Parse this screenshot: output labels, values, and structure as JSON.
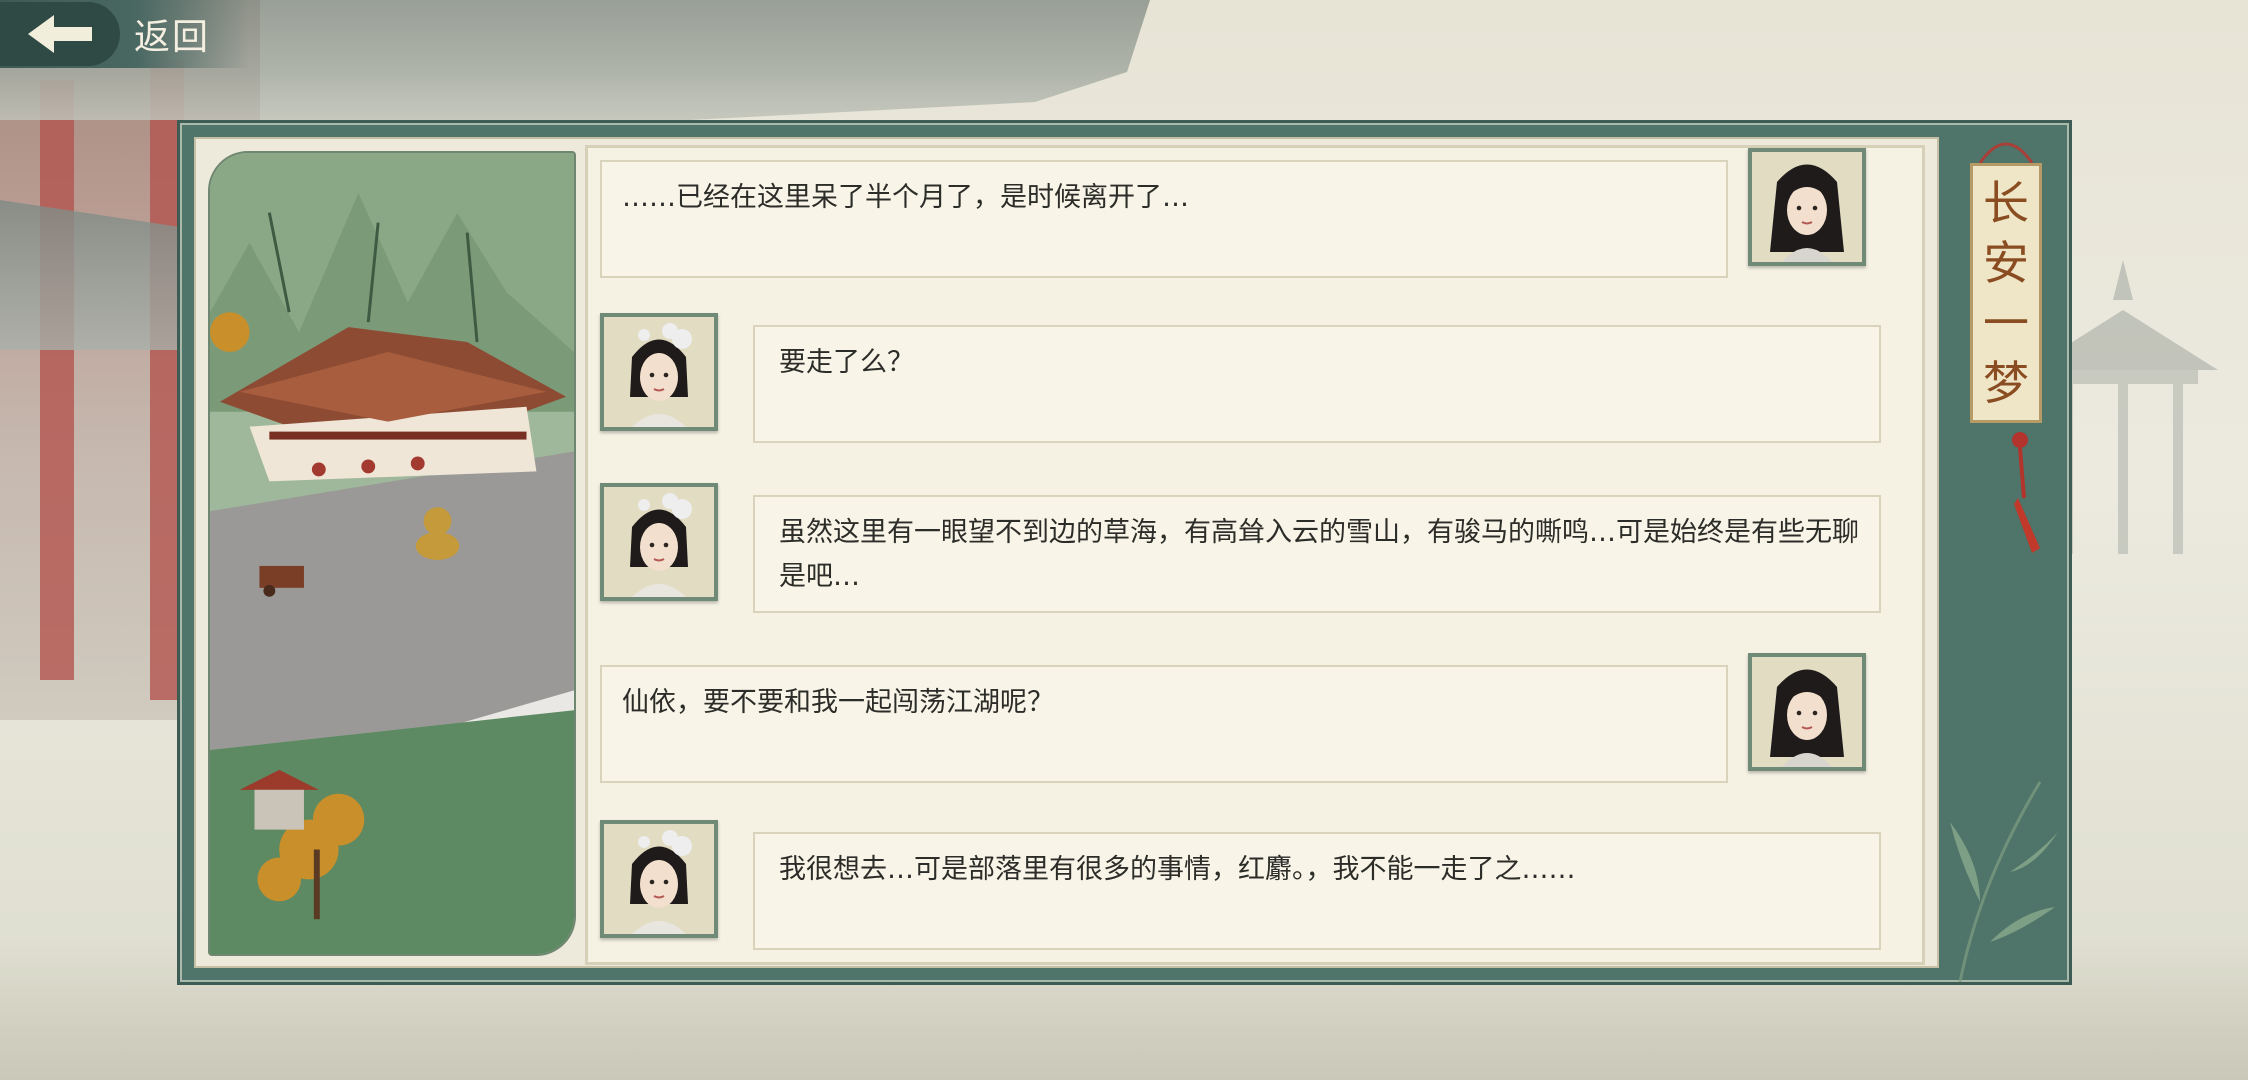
{
  "back_button": {
    "label": "返回",
    "icon": "back-arrow-icon"
  },
  "title": [
    "长",
    "安",
    "一",
    "梦"
  ],
  "colors": {
    "frame": "#4f7469",
    "panel": "#f5f2e3",
    "bubble": "#f8f5e8",
    "text": "#2c2c28",
    "title_text": "#8a4d22"
  },
  "messages": [
    {
      "speaker": "protagonist",
      "side": "right",
      "avatar": "long-hair-woman-avatar",
      "text": "……已经在这里呆了半个月了，是时候离开了…"
    },
    {
      "speaker": "xianyi",
      "side": "left",
      "avatar": "ornament-hair-woman-avatar",
      "text": "要走了么？"
    },
    {
      "speaker": "xianyi",
      "side": "left",
      "avatar": "ornament-hair-woman-avatar",
      "text": "虽然这里有一眼望不到边的草海，有高耸入云的雪山，有骏马的嘶鸣…可是始终是有些无聊是吧…"
    },
    {
      "speaker": "protagonist",
      "side": "right",
      "avatar": "long-hair-woman-avatar",
      "text": "仙依，要不要和我一起闯荡江湖呢？"
    },
    {
      "speaker": "xianyi",
      "side": "left",
      "avatar": "ornament-hair-woman-avatar",
      "text": "我很想去…可是部落里有很多的事情，红麝。，我不能一走了之……"
    }
  ]
}
